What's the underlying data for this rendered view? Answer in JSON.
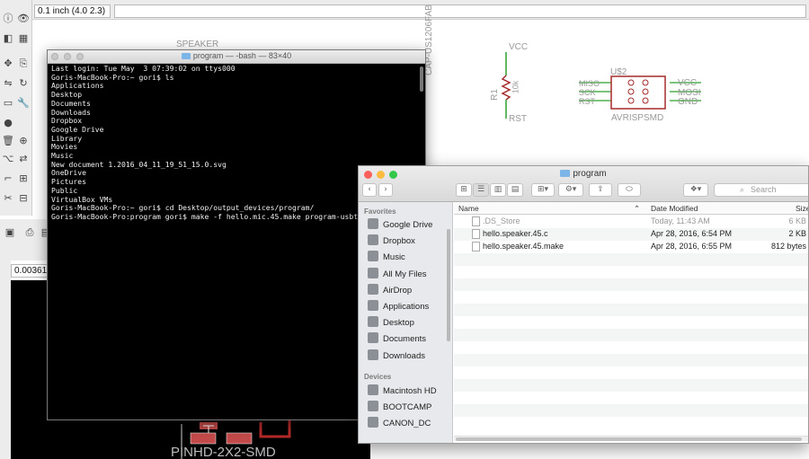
{
  "eagle": {
    "coord_readout": "0.1 inch (4.0 2.3)",
    "board_coord_readout": "0.00361",
    "schematic_labels": {
      "speaker": "SPEAKER",
      "cap": "CAP-US1206FAB",
      "vcc_top": "VCC",
      "r1": "R1",
      "r1_value": "10k",
      "rst_bottom": "RST",
      "u2": "U$2",
      "avrisp": "AVRISPSMD",
      "miso": "MISO",
      "sck": "SCK",
      "rst": "RST",
      "vcc": "VCC",
      "mosi": "MOSI",
      "gnd": "GND",
      "pin_miso": "MISO",
      "pin_sck": "SCK",
      "pin_rst": "RST",
      "pin_vcc": "VCC",
      "pin_mosi": "MOSI",
      "pin_gnd": "GND"
    },
    "board_label": "PINHD-2X2-SMD"
  },
  "terminal": {
    "title": "program — -bash — 83×40",
    "lines": [
      "Last login: Tue May  3 07:39:02 on ttys000",
      "Goris-MacBook-Pro:~ gori$ ls",
      "Applications",
      "Desktop",
      "Documents",
      "Downloads",
      "Dropbox",
      "Google Drive",
      "Library",
      "Movies",
      "Music",
      "New document 1.2016_04_11_19_51_15.0.svg",
      "OneDrive",
      "Pictures",
      "Public",
      "VirtualBox VMs",
      "Goris-MacBook-Pro:~ gori$ cd Desktop/output_devices/program/",
      "Goris-MacBook-Pro:program gori$ make -f hello.mic.45.make program-usbt"
    ]
  },
  "finder": {
    "title": "program",
    "search_placeholder": "Search",
    "sidebar": {
      "favorites_header": "Favorites",
      "favorites": [
        {
          "label": "Google Drive",
          "icon": "google-drive-icon"
        },
        {
          "label": "Dropbox",
          "icon": "dropbox-folder-icon"
        },
        {
          "label": "Music",
          "icon": "music-icon"
        },
        {
          "label": "All My Files",
          "icon": "all-files-icon"
        },
        {
          "label": "AirDrop",
          "icon": "airdrop-icon"
        },
        {
          "label": "Applications",
          "icon": "applications-icon"
        },
        {
          "label": "Desktop",
          "icon": "desktop-icon"
        },
        {
          "label": "Documents",
          "icon": "documents-icon"
        },
        {
          "label": "Downloads",
          "icon": "downloads-icon"
        }
      ],
      "devices_header": "Devices",
      "devices": [
        {
          "label": "Macintosh HD",
          "icon": "hard-drive-icon"
        },
        {
          "label": "BOOTCAMP",
          "icon": "hard-drive-icon"
        },
        {
          "label": "CANON_DC",
          "icon": "removable-drive-icon"
        }
      ]
    },
    "columns": {
      "name": "Name",
      "date": "Date Modified",
      "size": "Size"
    },
    "files": [
      {
        "name": ".DS_Store",
        "date": "Today, 11:43 AM",
        "size": "6 KB"
      },
      {
        "name": "hello.speaker.45.c",
        "date": "Apr 28, 2016, 6:54 PM",
        "size": "2 KB"
      },
      {
        "name": "hello.speaker.45.make",
        "date": "Apr 28, 2016, 6:55 PM",
        "size": "812 bytes"
      }
    ],
    "colors": {
      "close": "#fc605b",
      "minimize": "#fdbc40",
      "zoom": "#34c84a"
    }
  }
}
